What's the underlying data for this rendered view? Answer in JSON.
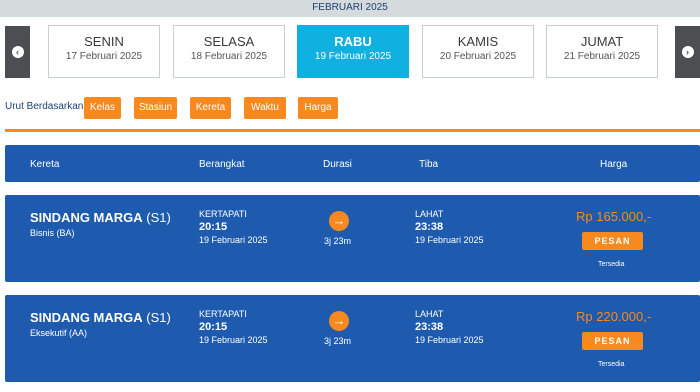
{
  "month": "FEBRUARI 2025",
  "nav": {
    "prev_icon": "chevron-left-icon",
    "next_icon": "chevron-right-icon",
    "prev_glyph": "‹",
    "next_glyph": "›"
  },
  "days": [
    {
      "name": "SENIN",
      "date": "17 Februari 2025",
      "active": false
    },
    {
      "name": "SELASA",
      "date": "18 Februari 2025",
      "active": false
    },
    {
      "name": "RABU",
      "date": "19 Februari 2025",
      "active": true
    },
    {
      "name": "KAMIS",
      "date": "20 Februari 2025",
      "active": false
    },
    {
      "name": "JUMAT",
      "date": "21 Februari 2025",
      "active": false
    }
  ],
  "sort": {
    "label": "Urut Berdasarkan:",
    "options": [
      "Kelas",
      "Stasiun",
      "Kereta",
      "Waktu",
      "Harga"
    ]
  },
  "columns": {
    "train": "Kereta",
    "depart": "Berangkat",
    "duration": "Durasi",
    "arrive": "Tiba",
    "price": "Harga"
  },
  "results": [
    {
      "train_name": "SINDANG MARGA",
      "train_code": "(S1)",
      "train_class": "Bisnis (BA)",
      "depart_station": "KERTAPATI",
      "depart_time": "20:15",
      "depart_date": "19 Februari 2025",
      "duration": "3j 23m",
      "arrive_station": "LAHAT",
      "arrive_time": "23:38",
      "arrive_date": "19 Februari 2025",
      "price": "Rp 165.000,-",
      "book_label": "PESAN",
      "availability": "Tersedia"
    },
    {
      "train_name": "SINDANG MARGA",
      "train_code": "(S1)",
      "train_class": "Eksekutif (AA)",
      "depart_station": "KERTAPATI",
      "depart_time": "20:15",
      "depart_date": "19 Februari 2025",
      "duration": "3j 23m",
      "arrive_station": "LAHAT",
      "arrive_time": "23:38",
      "arrive_date": "19 Februari 2025",
      "price": "Rp 220.000,-",
      "book_label": "PESAN",
      "availability": "Tersedia"
    }
  ],
  "colors": {
    "accent": "#f7891f",
    "primary": "#1e5bae",
    "active_day": "#10b0e0"
  }
}
